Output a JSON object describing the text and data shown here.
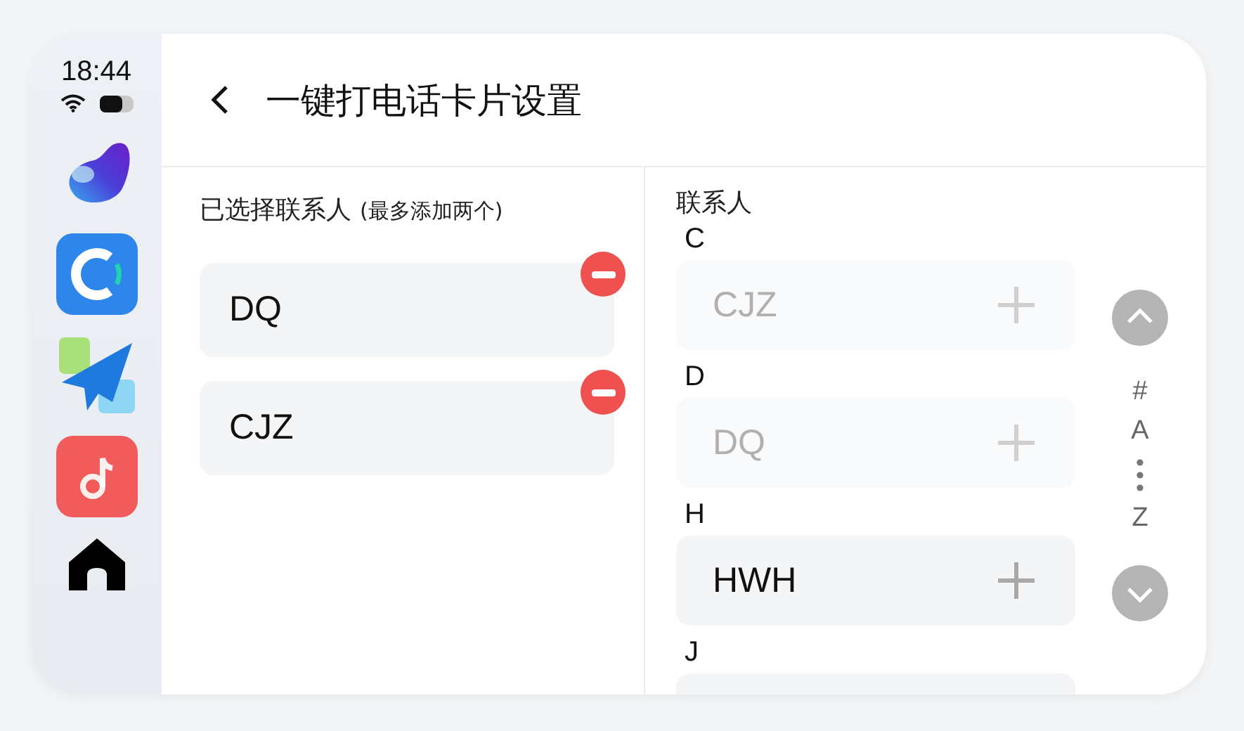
{
  "status_bar": {
    "time": "18:44"
  },
  "dock": {
    "apps": [
      {
        "kind": "blob"
      },
      {
        "kind": "ring"
      },
      {
        "kind": "plane"
      },
      {
        "kind": "music"
      },
      {
        "kind": "home"
      }
    ]
  },
  "header": {
    "title": "一键打电话卡片设置"
  },
  "selected_panel": {
    "title": "已选择联系人",
    "note": "(最多添加两个)",
    "contacts": [
      {
        "name": "DQ"
      },
      {
        "name": "CJZ"
      }
    ]
  },
  "contacts_panel": {
    "title": "联系人",
    "groups": [
      {
        "letter": "C",
        "contacts": [
          {
            "name": "CJZ",
            "added": true
          }
        ]
      },
      {
        "letter": "D",
        "contacts": [
          {
            "name": "DQ",
            "added": true
          }
        ]
      },
      {
        "letter": "H",
        "contacts": [
          {
            "name": "HWH",
            "added": false
          }
        ]
      },
      {
        "letter": "J",
        "cut_off_card": true
      }
    ],
    "index": [
      {
        "kind": "letter",
        "label": "#"
      },
      {
        "kind": "letter",
        "label": "A"
      },
      {
        "kind": "dots"
      },
      {
        "kind": "letter",
        "label": "Z"
      }
    ]
  }
}
